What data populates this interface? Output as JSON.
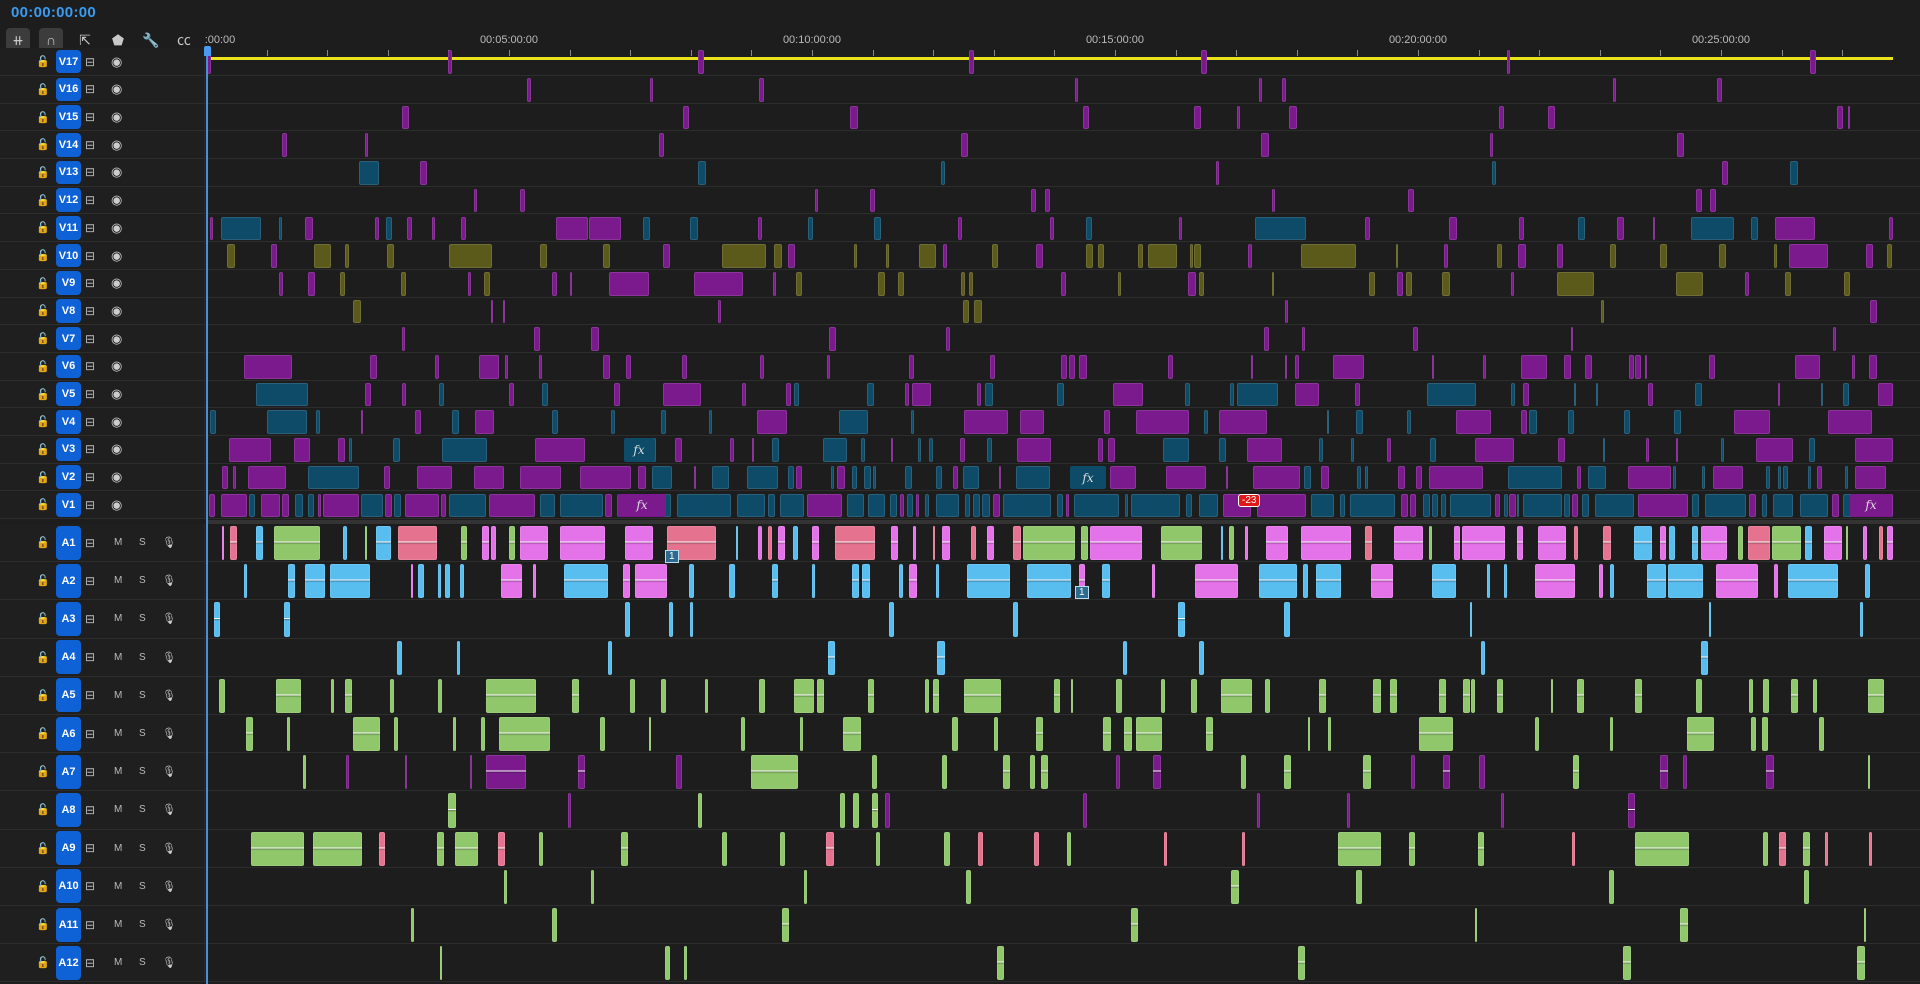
{
  "timecode": "00:00:00:00",
  "toolbar": [
    {
      "name": "insert-overwrite-sequences-icon",
      "glyph": "⧺"
    },
    {
      "name": "snap-magnet-icon",
      "glyph": "∩"
    },
    {
      "name": "linked-selection-icon",
      "glyph": "⇱"
    },
    {
      "name": "add-marker-icon",
      "glyph": "⬟"
    },
    {
      "name": "timeline-settings-wrench-icon",
      "glyph": "🔧"
    },
    {
      "name": "captions-cc-icon",
      "glyph": "㏄"
    }
  ],
  "ruler": {
    "labels": [
      ":00:00",
      "00:05:00:00",
      "00:10:00:00",
      "00:15:00:00",
      "00:20:00:00",
      "00:25:00:00"
    ]
  },
  "video_tracks": [
    "V17",
    "V16",
    "V15",
    "V14",
    "V13",
    "V12",
    "V11",
    "V10",
    "V9",
    "V8",
    "V7",
    "V6",
    "V5",
    "V4",
    "V3",
    "V2",
    "V1"
  ],
  "audio_tracks": [
    "A1",
    "A2",
    "A3",
    "A4",
    "A5",
    "A6",
    "A7",
    "A8",
    "A9",
    "A10",
    "A11",
    "A12"
  ],
  "audio_buttons": {
    "mute": "M",
    "solo": "S"
  },
  "clip_labels": {
    "fx": "fx",
    "track_count": "1",
    "level": "-23"
  },
  "colors": {
    "purple": "#7b1a8d",
    "teal": "#0d4b68",
    "olive": "#5b5a1b",
    "green": "#8fc76a",
    "blue": "#58bdef",
    "pink": "#e472e8",
    "rose": "#e5738f",
    "lavender": "#c49be8",
    "timecode": "#3a9bf0",
    "track_button": "#0f62d6",
    "work_area": "#e9e21c"
  }
}
